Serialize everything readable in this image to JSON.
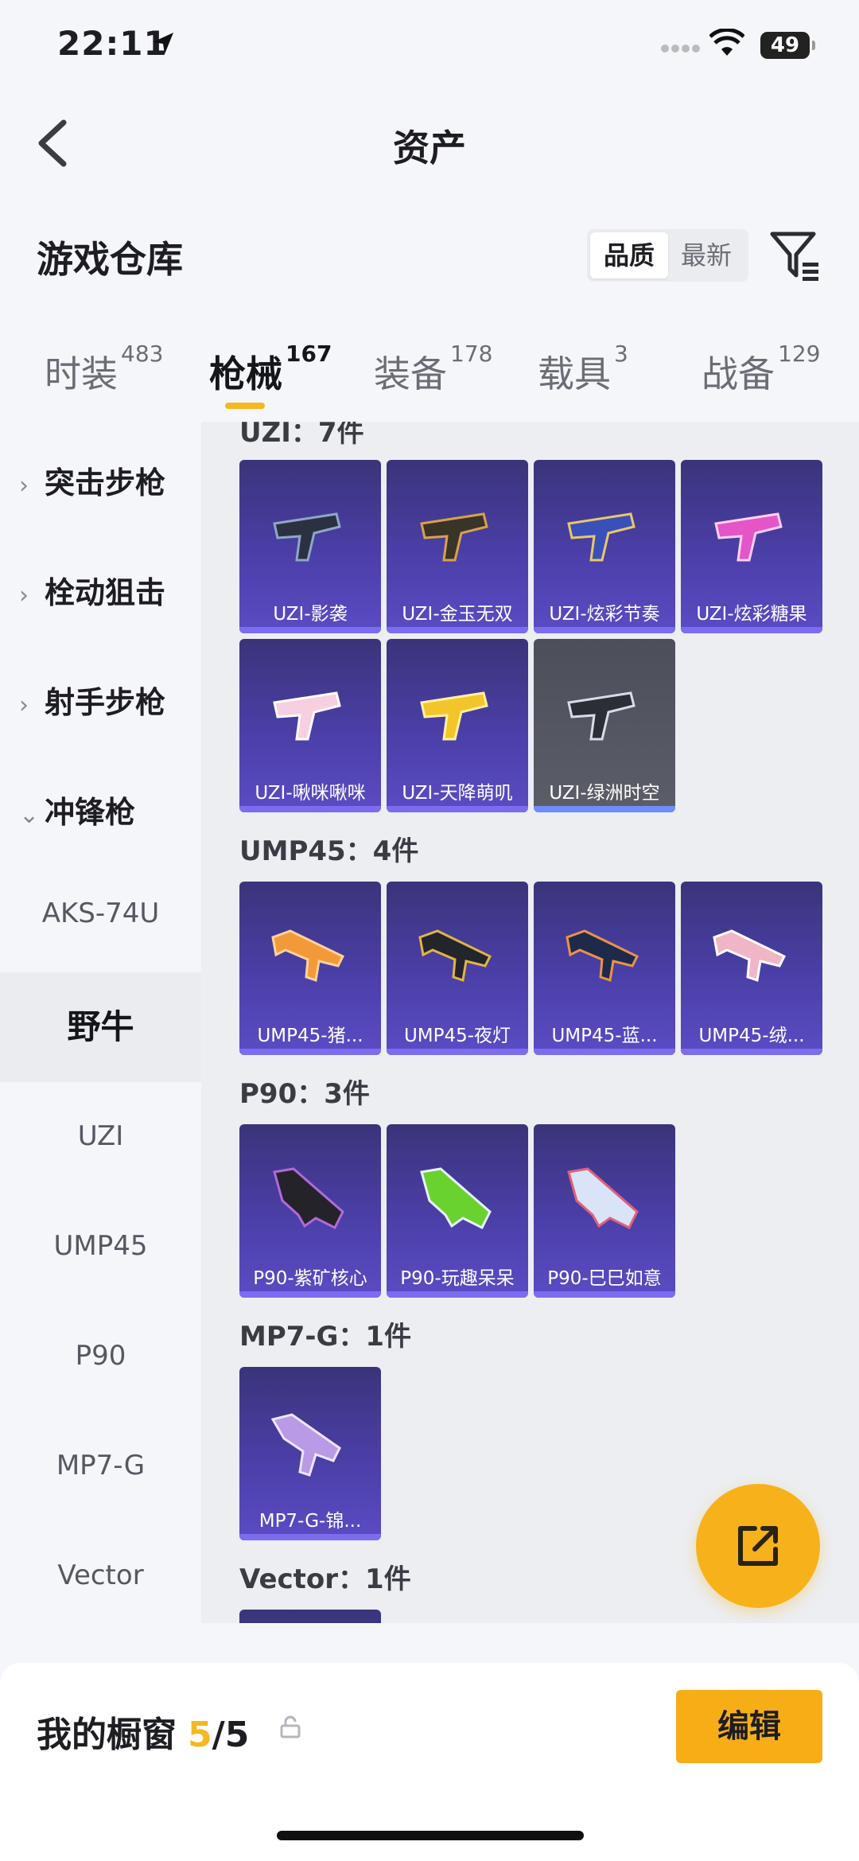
{
  "status_bar": {
    "time": "22:11",
    "battery": "49"
  },
  "nav": {
    "title": "资产"
  },
  "header": {
    "title": "游戏仓库",
    "sort_quality": "品质",
    "sort_latest": "最新"
  },
  "tabs": [
    {
      "label": "时装",
      "count": "483"
    },
    {
      "label": "枪械",
      "count": "167"
    },
    {
      "label": "装备",
      "count": "178"
    },
    {
      "label": "载具",
      "count": "3"
    },
    {
      "label": "战备",
      "count": "129"
    }
  ],
  "sidebar": {
    "categories": [
      "突击步枪",
      "栓动狙击",
      "射手步枪",
      "冲锋枪"
    ],
    "subs": [
      "AKS-74U",
      "野牛",
      "UZI",
      "UMP45",
      "P90",
      "MP7-G",
      "Vector"
    ]
  },
  "groups": [
    {
      "title": "UZI：7件",
      "items": [
        "UZI-影袭",
        "UZI-金玉无双",
        "UZI-炫彩节奏",
        "UZI-炫彩糖果",
        "UZI-啾咪啾咪",
        "UZI-天降萌叽",
        "UZI-绿洲时空"
      ]
    },
    {
      "title": "UMP45：4件",
      "items": [
        "UMP45-猪...",
        "UMP45-夜灯",
        "UMP45-蓝...",
        "UMP45-绒..."
      ]
    },
    {
      "title": "P90：3件",
      "items": [
        "P90-紫矿核心",
        "P90-玩趣呆呆",
        "P90-巳巳如意"
      ]
    },
    {
      "title": "MP7-G：1件",
      "items": [
        "MP7-G-锦..."
      ]
    },
    {
      "title": "Vector：1件",
      "items": []
    }
  ],
  "bottom": {
    "label": "我的橱窗",
    "current": "5",
    "total": "/5",
    "edit": "编辑"
  },
  "colors": {
    "accent": "#f7b21b",
    "card_purple": "#4b3fa8",
    "card_grey": "#5b5e68"
  }
}
